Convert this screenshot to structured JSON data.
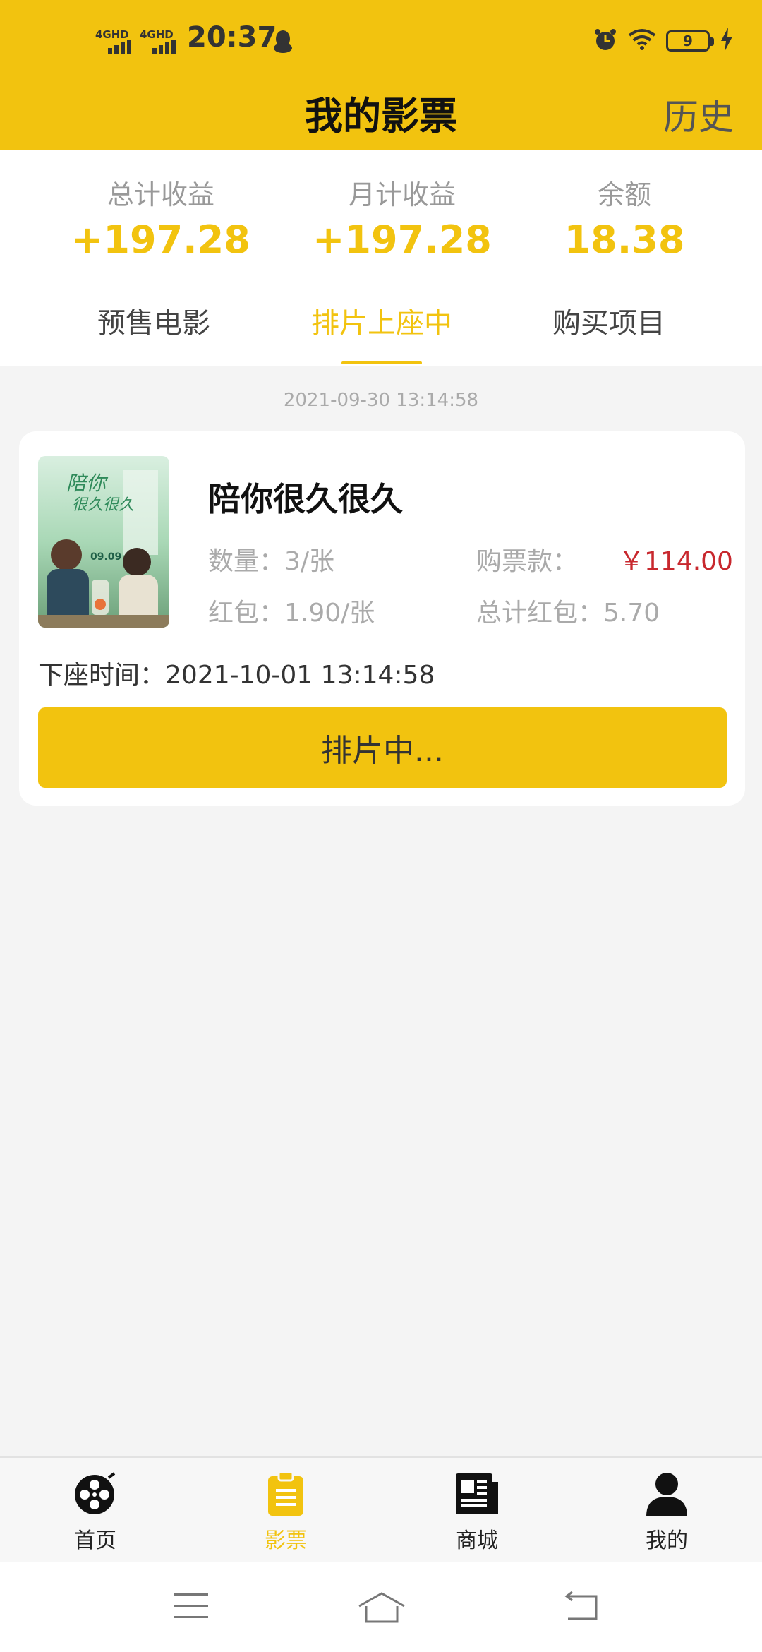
{
  "status_bar": {
    "signal1": "4GHD",
    "signal2": "4GHD",
    "time": "20:37",
    "battery": "9"
  },
  "header": {
    "title": "我的影票",
    "history": "历史"
  },
  "stats": [
    {
      "label": "总计收益",
      "value": "+197.28"
    },
    {
      "label": "月计收益",
      "value": "+197.28"
    },
    {
      "label": "余额",
      "value": "18.38"
    }
  ],
  "tabs": [
    {
      "label": "预售电影",
      "active": false
    },
    {
      "label": "排片上座中",
      "active": true
    },
    {
      "label": "购买项目",
      "active": false
    }
  ],
  "timestamp": "2021-09-30 13:14:58",
  "card": {
    "movie_title": "陪你很久很久",
    "quantity_label": "数量：",
    "quantity_value": "3/张",
    "price_label": "购票款：",
    "price_value": "￥114.00",
    "redpacket_label": "红包：",
    "redpacket_value": "1.90/张",
    "total_redpacket_label": "总计红包：",
    "total_redpacket_value": "5.70",
    "seat_time_label": "下座时间：",
    "seat_time_value": "2021-10-01 13:14:58",
    "button_label": "排片中...",
    "poster": {
      "title_art": "陪你很久很久",
      "date": "09.09"
    }
  },
  "bottom_nav": [
    {
      "label": "首页",
      "icon": "film-reel-icon",
      "active": false
    },
    {
      "label": "影票",
      "icon": "ticket-list-icon",
      "active": true
    },
    {
      "label": "商城",
      "icon": "newspaper-icon",
      "active": false
    },
    {
      "label": "我的",
      "icon": "person-icon",
      "active": false
    }
  ],
  "colors": {
    "accent": "#f2c30f",
    "price_red": "#c8282e",
    "background": "#f4f4f4"
  }
}
